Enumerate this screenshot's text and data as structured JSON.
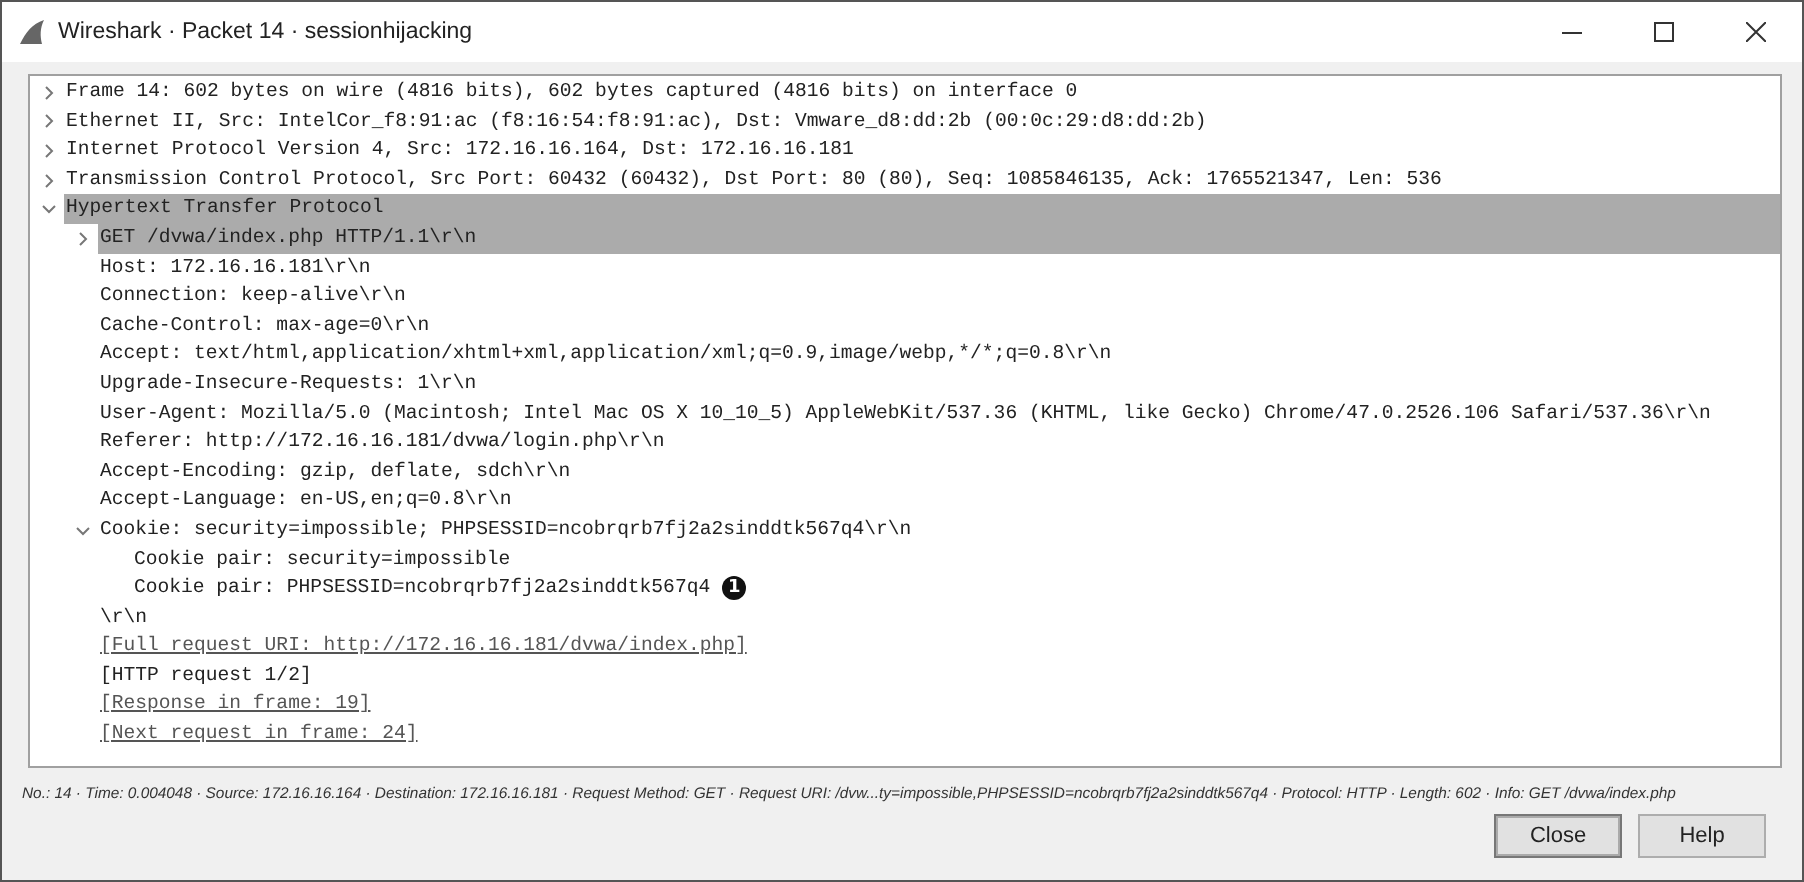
{
  "window": {
    "title": "Wireshark · Packet 14 · sessionhijacking"
  },
  "tree": [
    {
      "text": "Frame 14: 602 bytes on wire (4816 bits), 602 bytes captured (4816 bits) on interface 0",
      "kind": "field",
      "expanded": false,
      "selected": false
    },
    {
      "text": "Ethernet II, Src: IntelCor_f8:91:ac (f8:16:54:f8:91:ac), Dst: Vmware_d8:dd:2b (00:0c:29:d8:dd:2b)",
      "kind": "field",
      "expanded": false,
      "selected": false
    },
    {
      "text": "Internet Protocol Version 4, Src: 172.16.16.164, Dst: 172.16.16.181",
      "kind": "field",
      "expanded": false,
      "selected": false
    },
    {
      "text": "Transmission Control Protocol, Src Port: 60432 (60432), Dst Port: 80 (80), Seq: 1085846135, Ack: 1765521347, Len: 536",
      "kind": "field",
      "expanded": false,
      "selected": false
    },
    {
      "text": "Hypertext Transfer Protocol",
      "kind": "field",
      "expanded": true,
      "selected": true,
      "children": [
        {
          "text": "GET /dvwa/index.php HTTP/1.1\\r\\n",
          "kind": "field",
          "expanded": false,
          "selected": true
        },
        {
          "text": "Host: 172.16.16.181\\r\\n",
          "kind": "field",
          "selected": false
        },
        {
          "text": "Connection: keep-alive\\r\\n",
          "kind": "field",
          "selected": false
        },
        {
          "text": "Cache-Control: max-age=0\\r\\n",
          "kind": "field",
          "selected": false
        },
        {
          "text": "Accept: text/html,application/xhtml+xml,application/xml;q=0.9,image/webp,*/*;q=0.8\\r\\n",
          "kind": "field",
          "selected": false
        },
        {
          "text": "Upgrade-Insecure-Requests: 1\\r\\n",
          "kind": "field",
          "selected": false
        },
        {
          "text": "User-Agent: Mozilla/5.0 (Macintosh; Intel Mac OS X 10_10_5) AppleWebKit/537.36 (KHTML, like Gecko) Chrome/47.0.2526.106 Safari/537.36\\r\\n",
          "kind": "field",
          "selected": false
        },
        {
          "text": "Referer: http://172.16.16.181/dvwa/login.php\\r\\n",
          "kind": "field",
          "selected": false
        },
        {
          "text": "Accept-Encoding: gzip, deflate, sdch\\r\\n",
          "kind": "field",
          "selected": false
        },
        {
          "text": "Accept-Language: en-US,en;q=0.8\\r\\n",
          "kind": "field",
          "selected": false
        },
        {
          "text": "Cookie: security=impossible; PHPSESSID=ncobrqrb7fj2a2sinddtk567q4\\r\\n",
          "kind": "field",
          "expanded": true,
          "selected": false,
          "children": [
            {
              "text": "Cookie pair: security=impossible",
              "kind": "field",
              "selected": false
            },
            {
              "text": "Cookie pair: PHPSESSID=ncobrqrb7fj2a2sinddtk567q4",
              "kind": "field",
              "selected": false,
              "annotation": "1"
            }
          ]
        },
        {
          "text": "\\r\\n",
          "kind": "field",
          "selected": false
        },
        {
          "text": "[Full request URI: http://172.16.16.181/dvwa/index.php]",
          "kind": "link",
          "selected": false
        },
        {
          "text": "[HTTP request 1/2]",
          "kind": "field",
          "selected": false
        },
        {
          "text": "[Response in frame: 19]",
          "kind": "link",
          "selected": false
        },
        {
          "text": "[Next request in frame: 24]",
          "kind": "link",
          "selected": false
        }
      ]
    }
  ],
  "status_bar": "No.: 14 · Time: 0.004048 · Source: 172.16.16.164 · Destination: 172.16.16.181 · Request Method: GET · Request URI: /dvw...ty=impossible,PHPSESSID=ncobrqrb7fj2a2sinddtk567q4 · Protocol: HTTP · Length: 602 · Info: GET /dvwa/index.php",
  "buttons": [
    {
      "label": "Close",
      "selected": true
    },
    {
      "label": "Help",
      "selected": false
    }
  ]
}
